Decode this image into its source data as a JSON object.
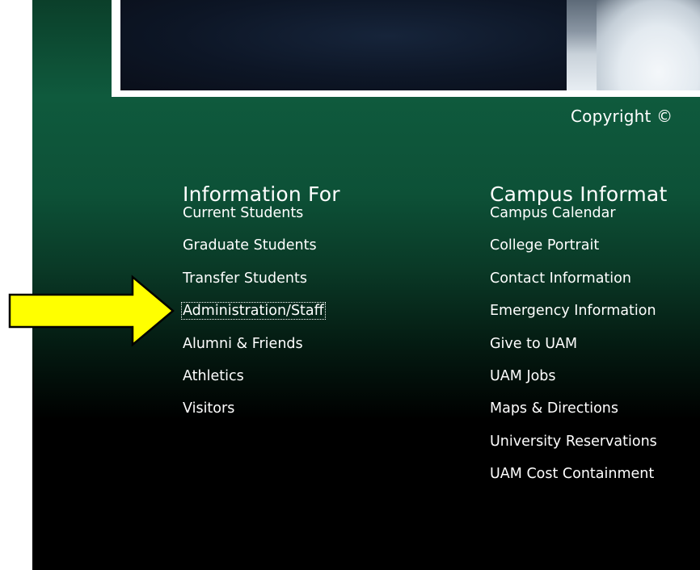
{
  "copyright": {
    "text": "Copyright ©"
  },
  "info_for": {
    "heading": "Information For",
    "links": [
      "Current Students",
      "Graduate Students",
      "Transfer Students",
      "Administration/Staff",
      "Alumni & Friends",
      "Athletics",
      "Visitors"
    ],
    "focused_index": 3
  },
  "campus_info": {
    "heading": "Campus Informat",
    "links": [
      "Campus Calendar",
      "College Portrait",
      "Contact Information",
      "Emergency Information",
      "Give to UAM",
      "UAM Jobs",
      "Maps & Directions",
      "University Reservations",
      "UAM Cost Containment"
    ]
  },
  "colors": {
    "footer_green": "#0f5a3d",
    "arrow_fill": "#ffff00",
    "arrow_stroke": "#000000",
    "link_text": "#ffffff"
  },
  "annotation": {
    "icon": "arrow-right-icon",
    "points_to": "Administration/Staff"
  }
}
